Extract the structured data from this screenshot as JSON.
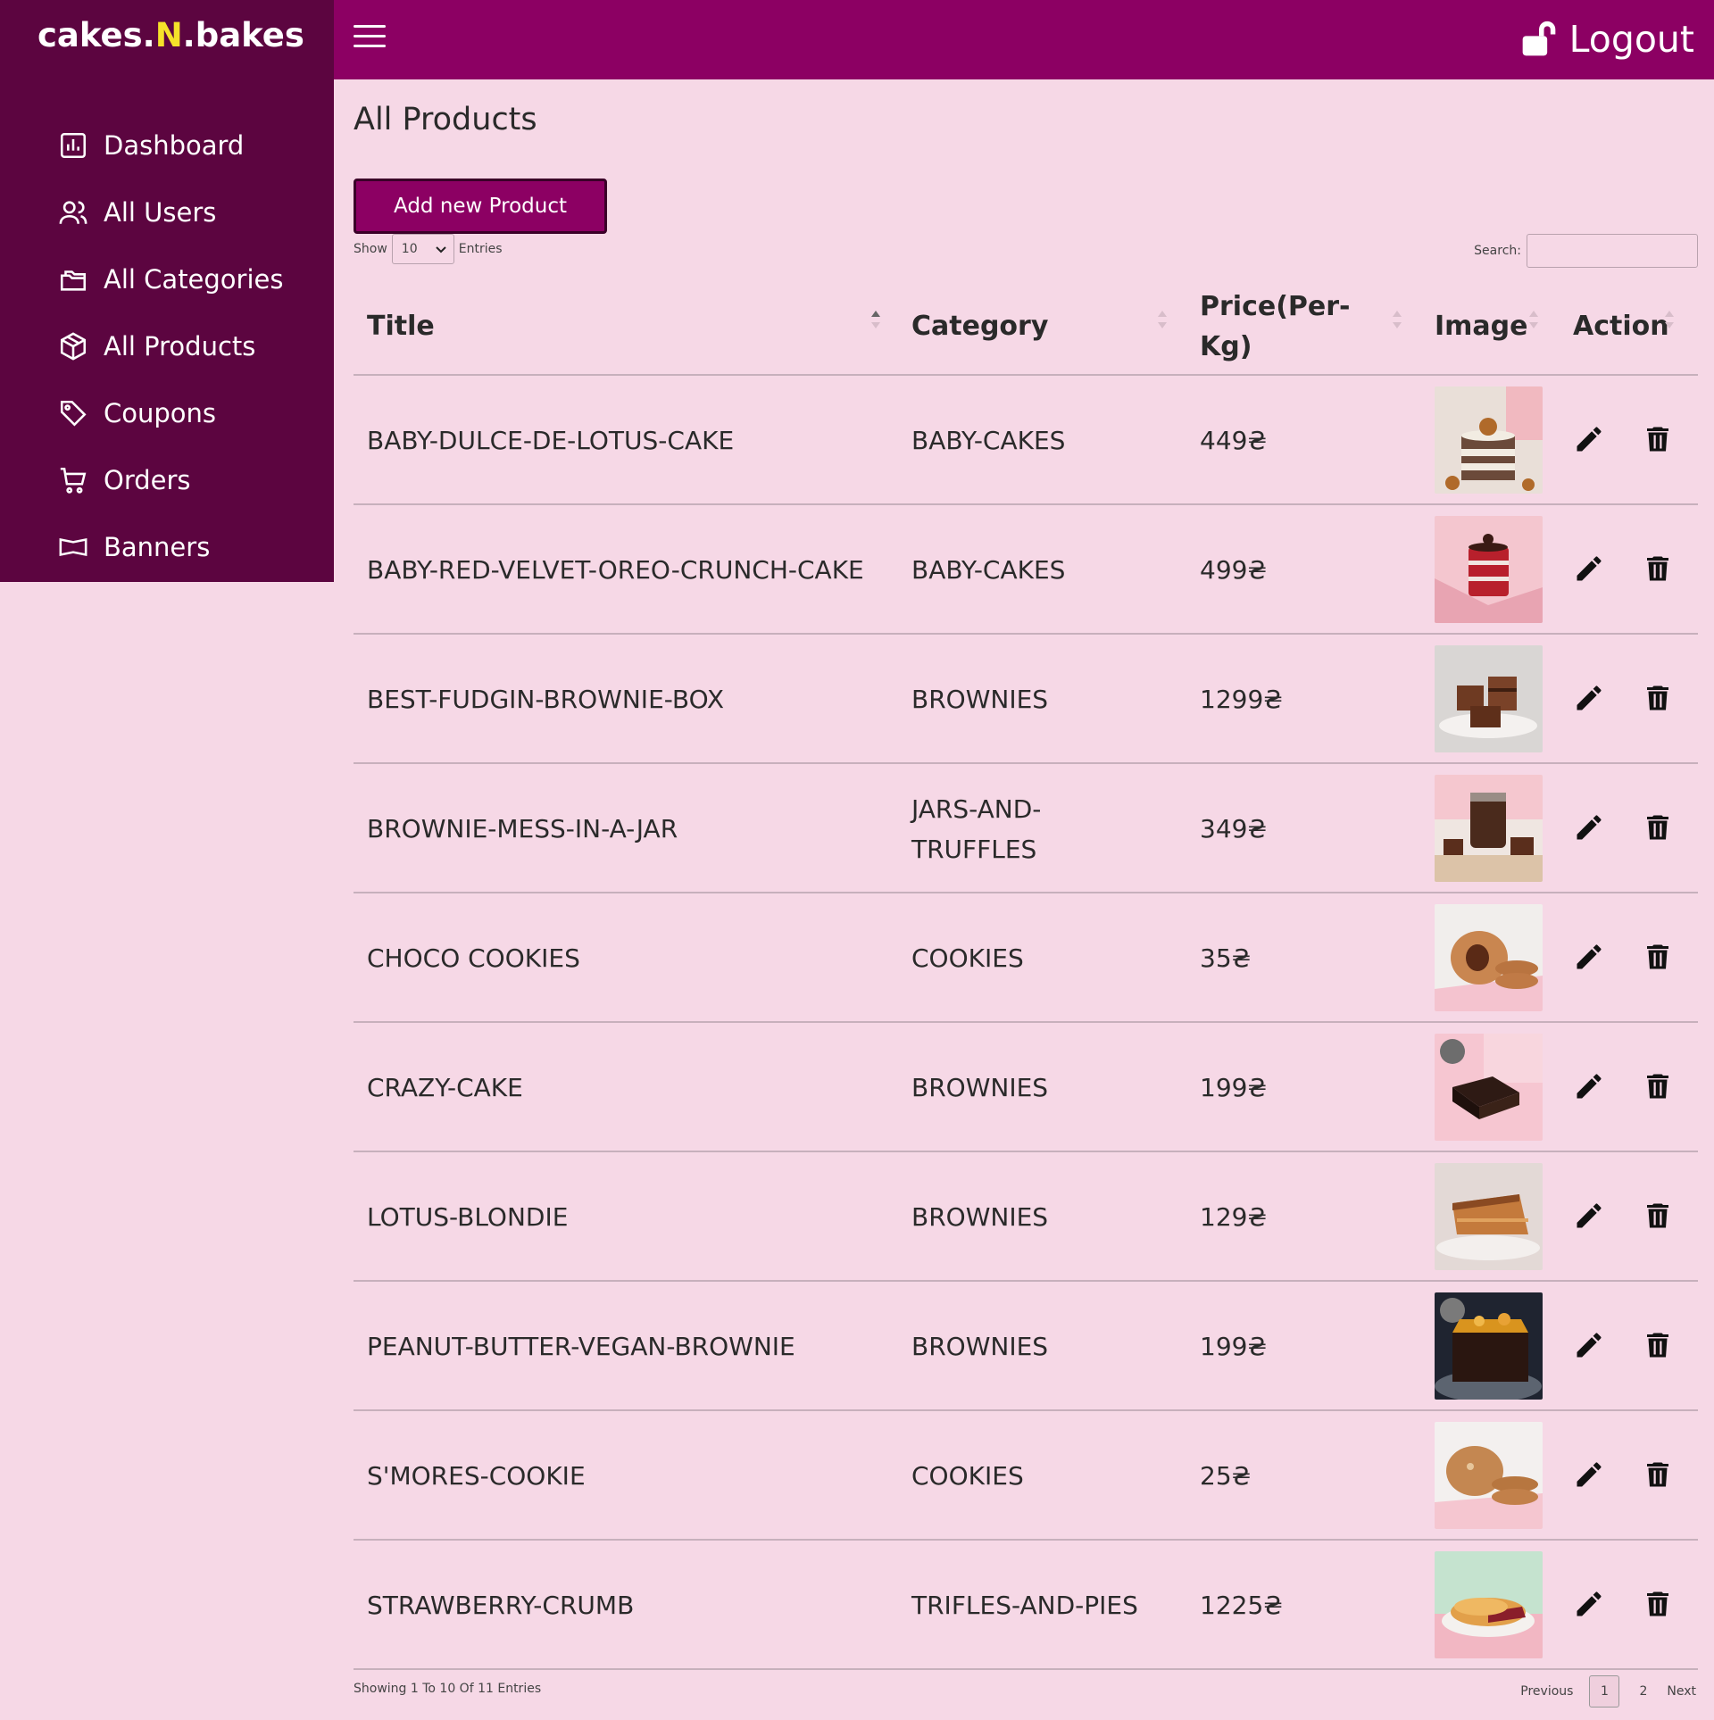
{
  "brand": {
    "part1": "cakes.",
    "part2": "N",
    "part3": ".bakes"
  },
  "colors": {
    "sidebar": "#5c0540",
    "topbar": "#8c0063",
    "page_bg": "#f6d8e6",
    "brand_highlight": "#f5e12a"
  },
  "sidebar": {
    "items": [
      {
        "label": "Dashboard",
        "icon": "chart-icon"
      },
      {
        "label": "All Users",
        "icon": "users-icon"
      },
      {
        "label": "All Categories",
        "icon": "folders-icon"
      },
      {
        "label": "All Products",
        "icon": "box-icon"
      },
      {
        "label": "Coupons",
        "icon": "tag-icon"
      },
      {
        "label": "Orders",
        "icon": "cart-icon"
      },
      {
        "label": "Banners",
        "icon": "banner-icon"
      }
    ]
  },
  "header": {
    "logout_label": "Logout",
    "menu_icon": "hamburger-icon",
    "logout_icon": "unlock-icon"
  },
  "main": {
    "title": "All Products",
    "add_button": "Add new Product",
    "show_label": "Show",
    "entries_value": "10",
    "entries_label": "Entries",
    "search_label": "Search:",
    "search_value": ""
  },
  "table": {
    "columns": [
      "Title",
      "Category",
      "Price(Per-Kg)",
      "Image",
      "Action"
    ],
    "price_col_line1": "Price(Per-",
    "price_col_line2": "Kg)",
    "rows": [
      {
        "title": "BABY-DULCE-DE-LOTUS-CAKE",
        "category": "BABY-CAKES",
        "price": "449₴"
      },
      {
        "title": "BABY-RED-VELVET-OREO-CRUNCH-CAKE",
        "category": "BABY-CAKES",
        "price": "499₴"
      },
      {
        "title": "BEST-FUDGIN-BROWNIE-BOX",
        "category": "BROWNIES",
        "price": "1299₴"
      },
      {
        "title": "BROWNIE-MESS-IN-A-JAR",
        "category": "JARS-AND-TRUFFLES",
        "price": "349₴"
      },
      {
        "title": "CHOCO COOKIES",
        "category": "COOKIES",
        "price": "35₴"
      },
      {
        "title": "CRAZY-CAKE",
        "category": "BROWNIES",
        "price": "199₴"
      },
      {
        "title": "LOTUS-BLONDIE",
        "category": "BROWNIES",
        "price": "129₴"
      },
      {
        "title": "PEANUT-BUTTER-VEGAN-BROWNIE",
        "category": "BROWNIES",
        "price": "199₴"
      },
      {
        "title": "S'MORES-COOKIE",
        "category": "COOKIES",
        "price": "25₴"
      },
      {
        "title": "STRAWBERRY-CRUMB",
        "category": "TRIFLES-AND-PIES",
        "price": "1225₴"
      }
    ]
  },
  "footer": {
    "info": "Showing 1 To 10 Of 11 Entries",
    "previous": "Previous",
    "pages": [
      "1",
      "2"
    ],
    "next": "Next"
  }
}
